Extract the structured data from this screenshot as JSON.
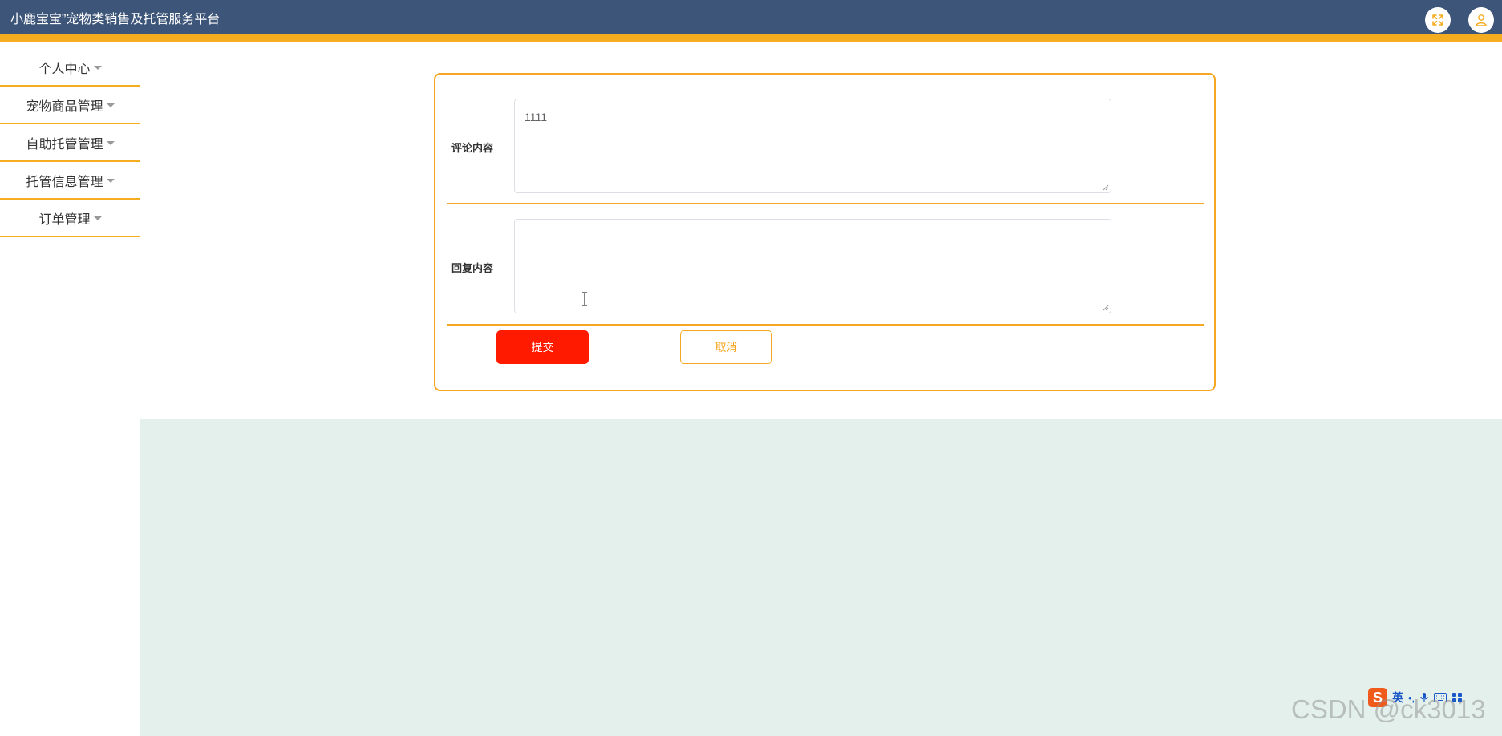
{
  "header": {
    "title": "小鹿宝宝”宠物类销售及托管服务平台",
    "icons": [
      "fullscreen-icon",
      "user-icon"
    ],
    "colors": {
      "bar": "#3c5578",
      "stripe": "#f5ac1f"
    }
  },
  "sidebar": {
    "items": [
      {
        "label": "个人中心"
      },
      {
        "label": "宠物商品管理"
      },
      {
        "label": "自助托管管理"
      },
      {
        "label": "托管信息管理"
      },
      {
        "label": "订单管理"
      }
    ]
  },
  "form": {
    "comment": {
      "label": "评论内容",
      "value": "1111"
    },
    "reply": {
      "label": "回复内容",
      "value": ""
    },
    "buttons": {
      "submit": "提交",
      "cancel": "取消"
    },
    "colors": {
      "border": "#f5a623",
      "submit_bg": "#ff1a00"
    }
  },
  "ime_toolbar": {
    "logo": "S",
    "lang": "英",
    "punct": "•,",
    "icons": [
      "microphone-icon",
      "keyboard-icon",
      "grid-menu-icon"
    ]
  },
  "watermark": "CSDN @ck3013"
}
